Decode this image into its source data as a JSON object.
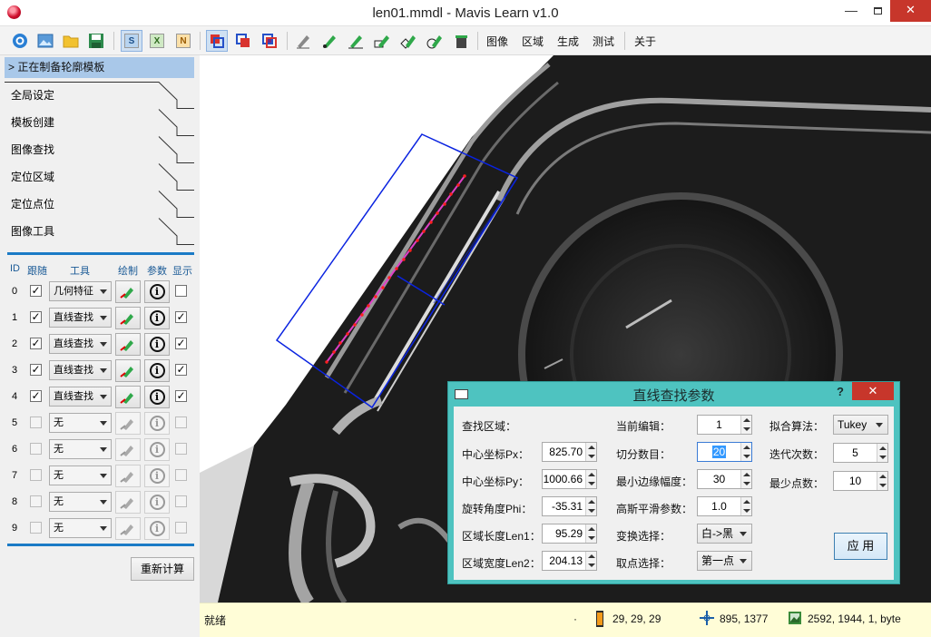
{
  "window": {
    "title": "len01.mmdl - Mavis Learn v1.0"
  },
  "toolbar": {
    "sxn": [
      "S",
      "X",
      "N"
    ],
    "menus": [
      "图像",
      "区域",
      "生成",
      "测试",
      "关于"
    ]
  },
  "left": {
    "context_header": "> 正在制备轮廓模板",
    "steps": [
      "全局设定",
      "模板创建",
      "图像查找",
      "定位区域",
      "定位点位",
      "图像工具"
    ],
    "columns": [
      "ID",
      "跟随",
      "工具",
      "绘制",
      "参数",
      "显示"
    ],
    "rows": [
      {
        "id": "0",
        "follow": true,
        "tool": "几何特征",
        "show": false,
        "enabled": true
      },
      {
        "id": "1",
        "follow": true,
        "tool": "直线查找",
        "show": true,
        "enabled": true
      },
      {
        "id": "2",
        "follow": true,
        "tool": "直线查找",
        "show": true,
        "enabled": true
      },
      {
        "id": "3",
        "follow": true,
        "tool": "直线查找",
        "show": true,
        "enabled": true
      },
      {
        "id": "4",
        "follow": true,
        "tool": "直线查找",
        "show": true,
        "enabled": true
      },
      {
        "id": "5",
        "follow": false,
        "tool": "无",
        "show": false,
        "enabled": false
      },
      {
        "id": "6",
        "follow": false,
        "tool": "无",
        "show": false,
        "enabled": false
      },
      {
        "id": "7",
        "follow": false,
        "tool": "无",
        "show": false,
        "enabled": false
      },
      {
        "id": "8",
        "follow": false,
        "tool": "无",
        "show": false,
        "enabled": false
      },
      {
        "id": "9",
        "follow": false,
        "tool": "无",
        "show": false,
        "enabled": false
      }
    ],
    "recalc_label": "重新计算"
  },
  "dialog": {
    "title": "直线查找参数",
    "help": "?",
    "close": "✕",
    "col1": {
      "region_label": "查找区域：",
      "px_label": "中心坐标Px：",
      "px": "825.70",
      "py_label": "中心坐标Py：",
      "py": "1000.66",
      "phi_label": "旋转角度Phi：",
      "phi": "-35.31",
      "len1_label": "区域长度Len1：",
      "len1": "95.29",
      "len2_label": "区域宽度Len2：",
      "len2": "204.13"
    },
    "col2": {
      "edit_label": "当前编辑：",
      "edit": "1",
      "split_label": "切分数目：",
      "split": "20",
      "edge_label": "最小边缘幅度：",
      "edge": "30",
      "sigma_label": "高斯平滑参数：",
      "sigma": "1.0",
      "transition_label": "变换选择：",
      "transition": "白->黑",
      "select_label": "取点选择：",
      "select": "第一点"
    },
    "col3": {
      "algo_label": "拟合算法：",
      "algo": "Tukey",
      "iter_label": "迭代次数：",
      "iter": "5",
      "min_label": "最少点数：",
      "min": "10"
    },
    "apply_label": "应 用"
  },
  "status": {
    "ready": "就绪",
    "dot": "·",
    "pixel": "29, 29, 29",
    "coords": "895, 1377",
    "image_info": "2592, 1944, 1, byte"
  }
}
